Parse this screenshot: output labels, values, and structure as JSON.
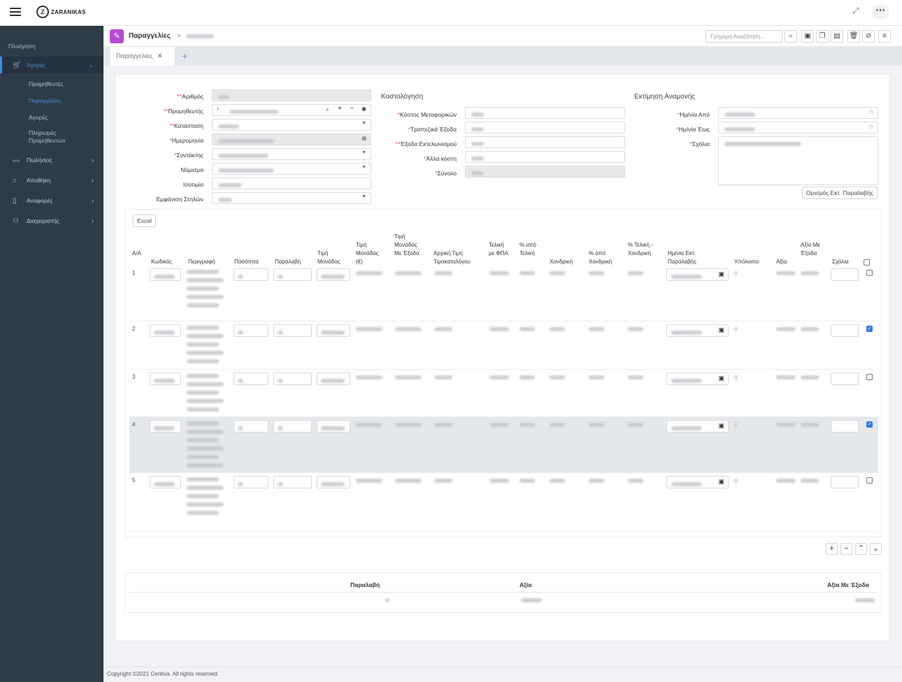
{
  "brand": {
    "name": "ZARANIKAS"
  },
  "sidebar": {
    "heading": "Πλοήγηση",
    "items": [
      {
        "label": "Αγορές",
        "icon": "cart-icon"
      },
      {
        "label": "Πωλήσεις",
        "icon": "chart-icon"
      },
      {
        "label": "Αποθήκη",
        "icon": "home-icon"
      },
      {
        "label": "Αναφορές",
        "icon": "file-icon"
      },
      {
        "label": "Διαχειριστής",
        "icon": "user-icon"
      }
    ],
    "sub_items": [
      "Προμηθευτές",
      "Παραγγελίες",
      "Αγορές",
      "Πληρωμές Προμηθευτών"
    ]
  },
  "header": {
    "title": "Παραγγελίες",
    "separator": ">",
    "search_placeholder": "Γρήγορη Αναζήτηση..."
  },
  "tabs": [
    {
      "label": "Παραγγελίες"
    }
  ],
  "form": {
    "left_labels": [
      "Αριθμός",
      "Προμηθευτής",
      "Κατάσταση",
      "Ημερομηνία",
      "Συντάκτης",
      "Νόμισμα",
      "Ισοτιμία",
      "Εμφάνιση Στηλών"
    ],
    "costing_title": "Κοστολόγηση",
    "costing_labels": [
      "Κόστος Μεταφορικών",
      "Τραπεζικά Έξοδα",
      "Έξοδα Εκτελωνισμού",
      "Άλλα κόστη",
      "Σύνολο"
    ],
    "estimate_title": "Εκτίμηση Αναμονής",
    "estimate_labels": [
      "Ημ/νία Από",
      "Ημ/νία Έως",
      "Σχόλια"
    ],
    "set_button": "Ορισμός Εκτ. Παραλαβής",
    "excel_button": "Excel"
  },
  "table": {
    "headers": [
      "Α/Α",
      "Κωδικός",
      "Περιγραφή",
      "Ποσότητα",
      "Παραλαβή",
      "Τιμή Μονάδος",
      "Τιμή Μονάδος (€)",
      "Τιμή Μονάδας Με Έξοδα",
      "Αρχική Τιμή Τιμοκαταλόγου",
      "Τελική με ΦΠΑ",
      "% από Τελική",
      "Χονδρική",
      "% από Χονδρική",
      "% Τελική - Χονδρική",
      "Ημ/νία Εκτ. Παραλαβής",
      "Υπόλοιπο",
      "Αξία",
      "Αξία Με Έξοδα",
      "Σχόλια"
    ],
    "rows": [
      {
        "num": "1",
        "checked": false
      },
      {
        "num": "2",
        "checked": true
      },
      {
        "num": "3",
        "checked": false
      },
      {
        "num": "4",
        "checked": true
      },
      {
        "num": "5",
        "checked": false
      }
    ]
  },
  "summary": {
    "headers": [
      "Παραλαβή",
      "Αξία",
      "Αξία Με Έξοδα"
    ]
  },
  "footer": {
    "text": "Copyright ©2021 Centiva. All rights reserved."
  }
}
